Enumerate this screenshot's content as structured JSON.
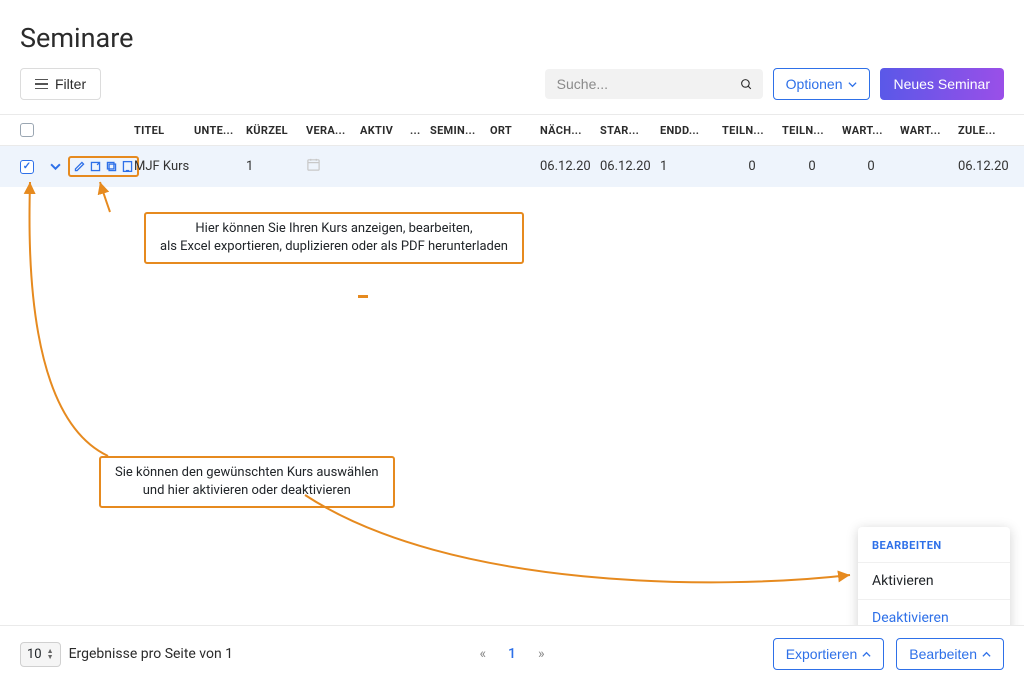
{
  "page_title": "Seminare",
  "toolbar": {
    "filter_label": "Filter",
    "search_placeholder": "Suche...",
    "options_label": "Optionen",
    "new_label": "Neues Seminar"
  },
  "columns": {
    "titel": "TITEL",
    "unte": "UNTE...",
    "kuerzel": "KÜRZEL",
    "vera": "VERA...",
    "aktiv": "AKTIV",
    "dots": "...",
    "semin": "SEMIN...",
    "ort": "ORT",
    "naech": "NÄCH...",
    "star": "STAR...",
    "endd": "ENDD...",
    "teiln1": "TEILN...",
    "teiln2": "TEILN...",
    "wart1": "WART...",
    "wart2": "WART...",
    "zule": "ZULE..."
  },
  "row": {
    "titel": "MJF Kurs",
    "kuerzel": "1",
    "naech": "06.12.20",
    "star": "06.12.20",
    "endd": "1",
    "teiln1": "0",
    "teiln2": "0",
    "wart1": "0",
    "zule": "06.12.20"
  },
  "annotations": {
    "a1_line1": "Hier können Sie Ihren Kurs anzeigen, bearbeiten,",
    "a1_line2": "als Excel exportieren, duplizieren oder als PDF herunterladen",
    "a2_line1": "Sie können den gewünschten Kurs auswählen",
    "a2_line2": "und hier aktivieren oder deaktivieren"
  },
  "dropdown": {
    "header": "BEARBEITEN",
    "activate": "Aktivieren",
    "deactivate": "Deaktivieren"
  },
  "footer": {
    "pagesize": "10",
    "results_label": "Ergebnisse pro Seite von 1",
    "page_prev": "«",
    "page_cur": "1",
    "page_next": "»",
    "export_label": "Exportieren",
    "edit_label": "Bearbeiten"
  }
}
